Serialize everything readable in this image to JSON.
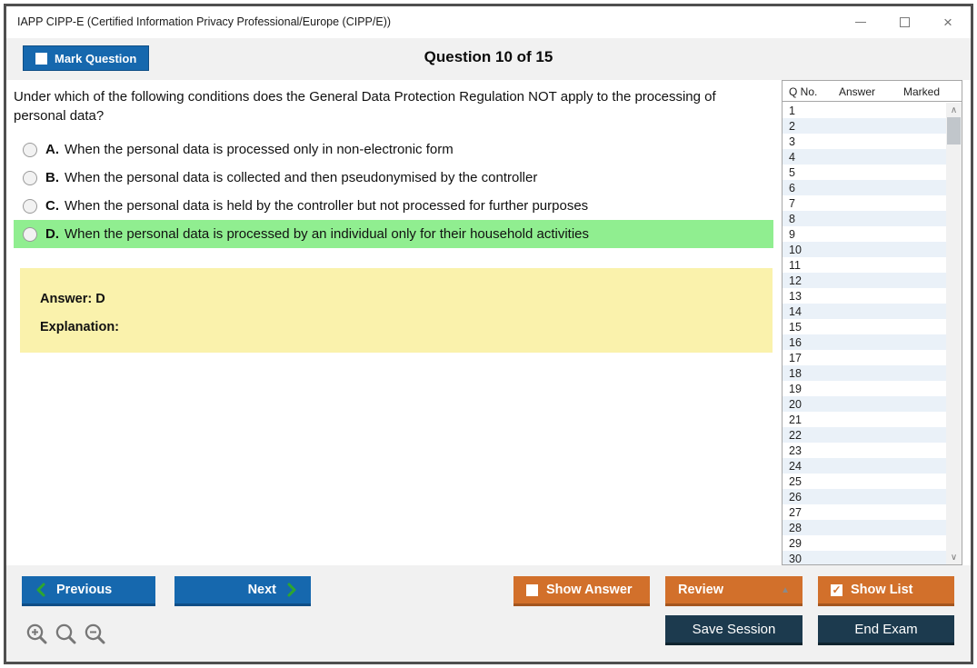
{
  "window": {
    "title": "IAPP CIPP-E (Certified Information Privacy Professional/Europe (CIPP/E))"
  },
  "header": {
    "mark_question_label": "Mark Question",
    "question_counter": "Question 10 of 15"
  },
  "question": {
    "text": "Under which of the following conditions does the General Data Protection Regulation NOT apply to the processing of personal data?",
    "options": [
      {
        "letter": "A.",
        "text": "When the personal data is processed only in non-electronic form",
        "highlighted": false,
        "selected": false
      },
      {
        "letter": "B.",
        "text": "When the personal data is collected and then pseudonymised by the controller",
        "highlighted": false,
        "selected": false
      },
      {
        "letter": "C.",
        "text": "When the personal data is held by the controller but not processed for further purposes",
        "highlighted": false,
        "selected": false
      },
      {
        "letter": "D.",
        "text": "When the personal data is processed by an individual only for their household activities",
        "highlighted": true,
        "selected": false
      }
    ],
    "answer_label": "Answer: D",
    "explanation_label": "Explanation:"
  },
  "question_list": {
    "columns": {
      "q_no": "Q No.",
      "answer": "Answer",
      "marked": "Marked"
    },
    "rows": [
      {
        "q": "1",
        "answer": "",
        "marked": ""
      },
      {
        "q": "2",
        "answer": "",
        "marked": ""
      },
      {
        "q": "3",
        "answer": "",
        "marked": ""
      },
      {
        "q": "4",
        "answer": "",
        "marked": ""
      },
      {
        "q": "5",
        "answer": "",
        "marked": ""
      },
      {
        "q": "6",
        "answer": "",
        "marked": ""
      },
      {
        "q": "7",
        "answer": "",
        "marked": ""
      },
      {
        "q": "8",
        "answer": "",
        "marked": ""
      },
      {
        "q": "9",
        "answer": "",
        "marked": ""
      },
      {
        "q": "10",
        "answer": "",
        "marked": ""
      },
      {
        "q": "11",
        "answer": "",
        "marked": ""
      },
      {
        "q": "12",
        "answer": "",
        "marked": ""
      },
      {
        "q": "13",
        "answer": "",
        "marked": ""
      },
      {
        "q": "14",
        "answer": "",
        "marked": ""
      },
      {
        "q": "15",
        "answer": "",
        "marked": ""
      },
      {
        "q": "16",
        "answer": "",
        "marked": ""
      },
      {
        "q": "17",
        "answer": "",
        "marked": ""
      },
      {
        "q": "18",
        "answer": "",
        "marked": ""
      },
      {
        "q": "19",
        "answer": "",
        "marked": ""
      },
      {
        "q": "20",
        "answer": "",
        "marked": ""
      },
      {
        "q": "21",
        "answer": "",
        "marked": ""
      },
      {
        "q": "22",
        "answer": "",
        "marked": ""
      },
      {
        "q": "23",
        "answer": "",
        "marked": ""
      },
      {
        "q": "24",
        "answer": "",
        "marked": ""
      },
      {
        "q": "25",
        "answer": "",
        "marked": ""
      },
      {
        "q": "26",
        "answer": "",
        "marked": ""
      },
      {
        "q": "27",
        "answer": "",
        "marked": ""
      },
      {
        "q": "28",
        "answer": "",
        "marked": ""
      },
      {
        "q": "29",
        "answer": "",
        "marked": ""
      },
      {
        "q": "30",
        "answer": "",
        "marked": ""
      }
    ]
  },
  "footer": {
    "previous_label": "Previous",
    "next_label": "Next",
    "show_answer_label": "Show Answer",
    "review_label": "Review",
    "show_list_label": "Show List",
    "save_session_label": "Save Session",
    "end_exam_label": "End Exam"
  },
  "icons": {
    "mark_question_checkbox": "unchecked",
    "show_answer_checkbox": "unchecked",
    "show_list_checkbox": "checked",
    "check_glyph": "✓",
    "review_caret": "▲",
    "scroll_up": "∧",
    "scroll_down": "∨",
    "close_glyph": "×",
    "zoom_icons": [
      "magnifier-plus",
      "magnifier",
      "magnifier-minus"
    ]
  },
  "colors": {
    "accent_blue": "#1668AE",
    "accent_orange": "#D2702B",
    "accent_navy": "#1C3A4E",
    "highlight_green": "#90EE90",
    "answer_box_yellow": "#FAF2AC",
    "alt_row_blue": "#EAF1F8",
    "chevron_green": "#2EA62E"
  }
}
